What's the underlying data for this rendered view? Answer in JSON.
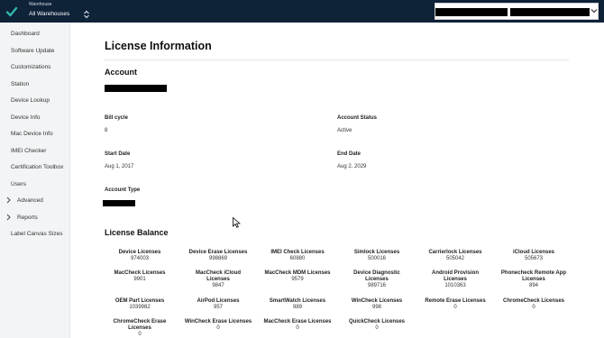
{
  "topbar": {
    "warehouse_label": "Warehouse",
    "warehouse_value": "All Warehouses"
  },
  "sidebar": {
    "items": [
      {
        "label": "Dashboard"
      },
      {
        "label": "Software Update"
      },
      {
        "label": "Customizations"
      },
      {
        "label": "Station"
      },
      {
        "label": "Device Lookup"
      },
      {
        "label": "Device Info"
      },
      {
        "label": "Mac Device Info"
      },
      {
        "label": "IMEI Checker"
      },
      {
        "label": "Certification Toolbox"
      },
      {
        "label": "Users"
      },
      {
        "label": "Advanced"
      },
      {
        "label": "Reports"
      },
      {
        "label": "Label Canvas Sizes"
      }
    ]
  },
  "main": {
    "title": "License Information",
    "account": {
      "heading": "Account",
      "bill_cycle_label": "Bill cycle",
      "bill_cycle_value": "8",
      "status_label": "Account Status",
      "status_value": "Active",
      "start_label": "Start Date",
      "start_value": "Aug 1, 2017",
      "end_label": "End Date",
      "end_value": "Aug 2, 2029",
      "type_label": "Account Type"
    },
    "balance": {
      "heading": "License Balance",
      "licenses": [
        {
          "name": "Device Licenses",
          "count": "974003"
        },
        {
          "name": "Device Erase Licenses",
          "count": "998869"
        },
        {
          "name": "IMEI Check Licenses",
          "count": "60880"
        },
        {
          "name": "Simlock Licenses",
          "count": "500016"
        },
        {
          "name": "Carrierlock Licenses",
          "count": "505042"
        },
        {
          "name": "iCloud Licenses",
          "count": "505673"
        },
        {
          "name": "MacCheck Licenses",
          "count": "9901"
        },
        {
          "name": "MacCheck iCloud Licenses",
          "count": "9847"
        },
        {
          "name": "MacCheck MDM Licenses",
          "count": "9579"
        },
        {
          "name": "Device Diagnostic Licenses",
          "count": "989716"
        },
        {
          "name": "Android Provision Licenses",
          "count": "1010363"
        },
        {
          "name": "Phonecheck Remote App Licenses",
          "count": "894"
        },
        {
          "name": "OEM Part Licenses",
          "count": "1039982"
        },
        {
          "name": "AirPod Licenses",
          "count": "957"
        },
        {
          "name": "SmartWatch Licenses",
          "count": "989"
        },
        {
          "name": "WinCheck Licenses",
          "count": "998"
        },
        {
          "name": "Remote Erase Licenses",
          "count": "0"
        },
        {
          "name": "ChromeCheck Licenses",
          "count": "0"
        },
        {
          "name": "ChromeCheck Erase Licenses",
          "count": "0"
        },
        {
          "name": "WinCheck Erase Licenses",
          "count": "0"
        },
        {
          "name": "MacCheck Erase Licenses",
          "count": "0"
        },
        {
          "name": "QuickCheck Licenses",
          "count": "0"
        }
      ]
    }
  },
  "colors": {
    "topbar_bg": "#0e2238",
    "logo_check": "#2fb6a6",
    "sidebar_bg": "#f3f4f5"
  },
  "icons": [
    "check-logo-icon",
    "sort-icon",
    "chevron-down-icon",
    "chevron-right-icon",
    "mouse-cursor-icon"
  ]
}
